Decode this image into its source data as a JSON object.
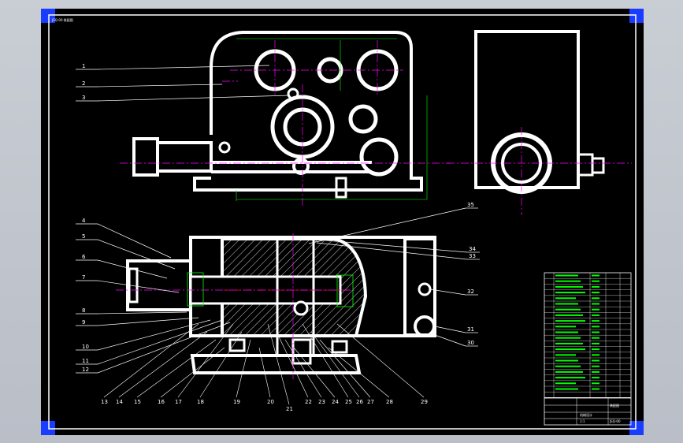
{
  "sheet": {
    "title_text": "装配图",
    "scale": "1:1",
    "drawing_number": "JSQ-00",
    "company_cell": "机械设计",
    "colors": {
      "background": "#000000",
      "outline": "#ffffff",
      "center_line": "#ff00ff",
      "dimension": "#00ff00",
      "hatch": "#ffffff",
      "corner_marker": "#1a3cff"
    }
  },
  "part_labels": {
    "left_column": [
      "1",
      "2",
      "3",
      "4",
      "5",
      "6",
      "7",
      "8",
      "9",
      "10",
      "11",
      "12"
    ],
    "bottom_row": [
      "13",
      "14",
      "15",
      "16",
      "17",
      "18",
      "19",
      "20",
      "21",
      "22",
      "23",
      "24",
      "25",
      "26",
      "27",
      "28",
      "29"
    ],
    "right_column": [
      "30",
      "31",
      "32",
      "33",
      "34",
      "35"
    ]
  },
  "parts_list_rows": 22
}
